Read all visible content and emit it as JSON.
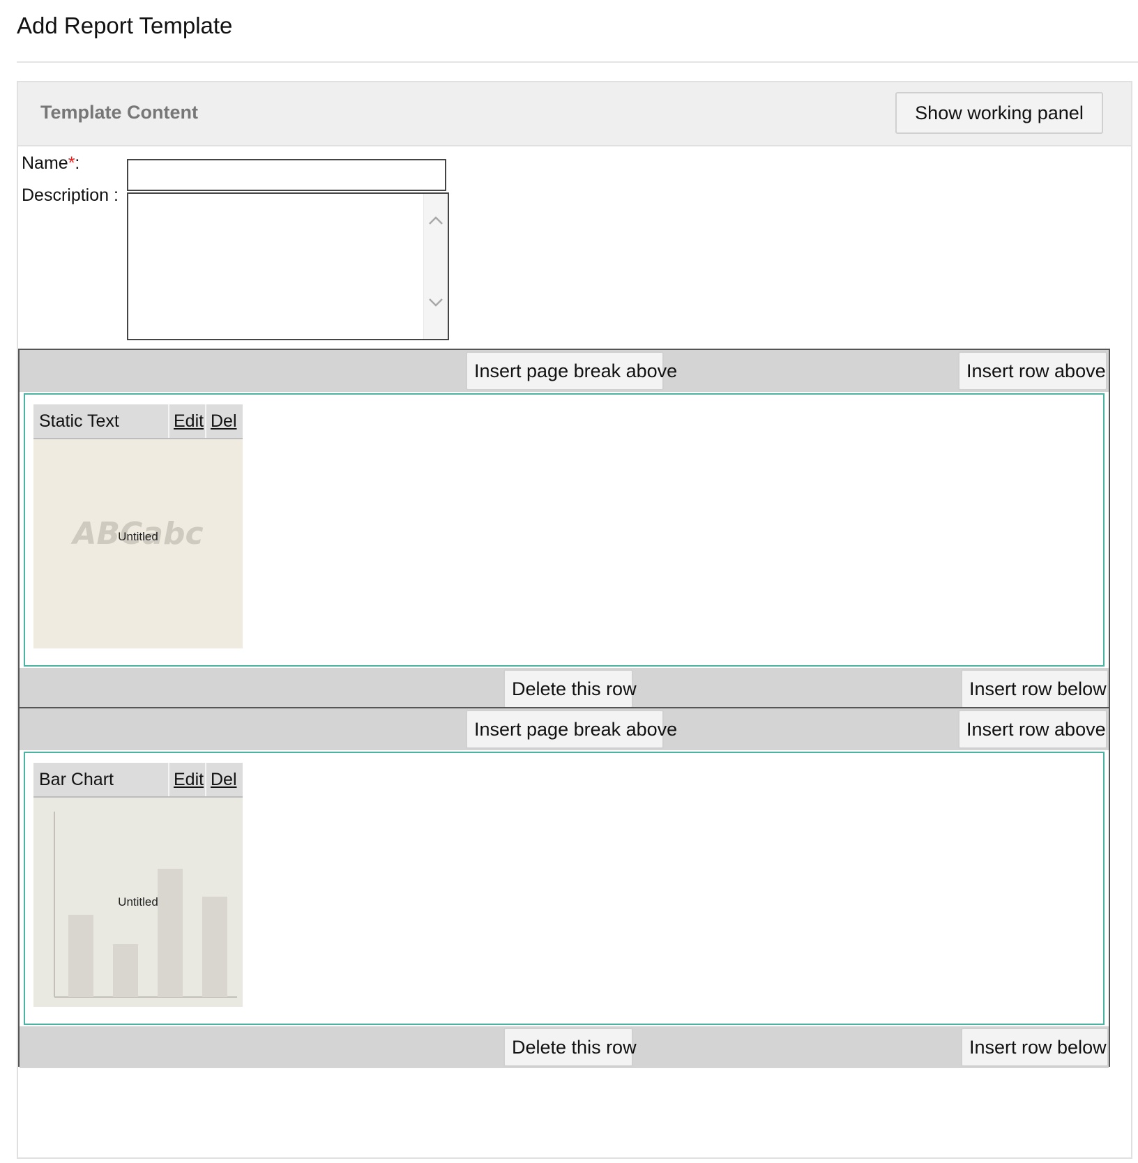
{
  "page": {
    "title": "Add Report Template"
  },
  "panel": {
    "title": "Template Content",
    "show_panel_label": "Show working panel"
  },
  "form": {
    "name_label": "Name",
    "required_mark": "*",
    "name_suffix": ":",
    "name_value": "",
    "description_label": "Description :",
    "description_value": ""
  },
  "rows": [
    {
      "insert_page_break_label": "Insert page break above",
      "insert_above_label": "Insert row above",
      "delete_label": "Delete this row",
      "insert_below_label": "Insert row below",
      "widget": {
        "type": "Static Text",
        "edit": "Edit",
        "del": "Del",
        "caption": "Untitled",
        "preview_text": "ABCabc",
        "preview": "static-text-icon"
      }
    },
    {
      "insert_page_break_label": "Insert page break above",
      "insert_above_label": "Insert row above",
      "delete_label": "Delete this row",
      "insert_below_label": "Insert row below",
      "widget": {
        "type": "Bar Chart",
        "edit": "Edit",
        "del": "Del",
        "caption": "Untitled",
        "preview": "bar-chart-icon"
      }
    }
  ],
  "colors": {
    "content_border": "#4bb3a0",
    "required": "#dd2222",
    "bar": "#d4d4d4"
  }
}
